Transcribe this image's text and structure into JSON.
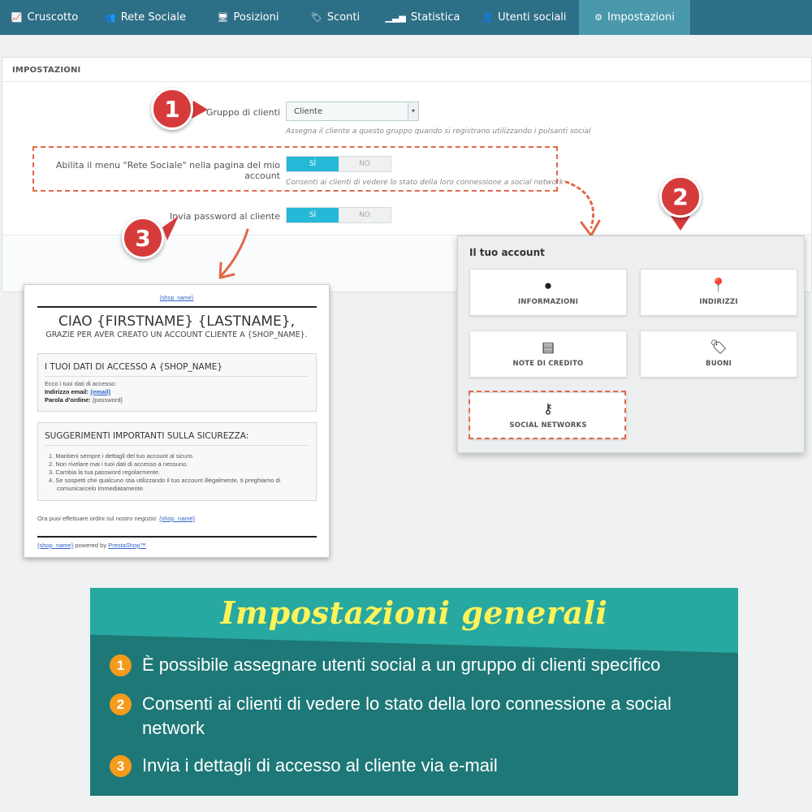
{
  "nav": {
    "tabs": [
      {
        "label": "Cruscotto",
        "icon": "chart-line-icon"
      },
      {
        "label": "Rete Sociale",
        "icon": "users-icon"
      },
      {
        "label": "Posizioni",
        "icon": "monitor-icon"
      },
      {
        "label": "Sconti",
        "icon": "tag-icon"
      },
      {
        "label": "Statistica",
        "icon": "bar-chart-icon"
      },
      {
        "label": "Utenti sociali",
        "icon": "user-icon"
      },
      {
        "label": "Impostazioni",
        "icon": "gear-icon",
        "active": true
      }
    ]
  },
  "settings": {
    "header": "IMPOSTAZIONI",
    "group_label": "Gruppo di clienti",
    "group_value": "Cliente",
    "group_hint": "Assegna il cliente a questo gruppo quando si registrano utilizzando i pulsanti social",
    "menu_label": "Abilita il menu \"Rete Sociale\" nella pagina del mio account",
    "menu_hint": "Consenti ai clienti di vedere lo stato della loro connessione a social network",
    "password_label": "Invia password al cliente",
    "toggle_yes": "SÌ",
    "toggle_no": "NO"
  },
  "badges": {
    "one": "1",
    "two": "2",
    "three": "3"
  },
  "account": {
    "title": "Il tuo account",
    "cards": [
      {
        "label": "INFORMAZIONI",
        "icon": "user-circle-icon"
      },
      {
        "label": "INDIRIZZI",
        "icon": "map-pin-icon"
      },
      {
        "label": "NOTE DI CREDITO",
        "icon": "receipt-icon"
      },
      {
        "label": "BUONI",
        "icon": "tag-icon"
      },
      {
        "label": "SOCIAL NETWORKS",
        "icon": "key-icon"
      }
    ]
  },
  "email": {
    "shop_name": "{shop_name}",
    "greeting": "CIAO {FIRSTNAME} {LASTNAME},",
    "thanks": "GRAZIE PER AVER CREATO UN ACCOUNT CLIENTE A {SHOP_NAME}.",
    "access_title": "I TUOI DATI DI ACCESSO A {SHOP_NAME}",
    "access_intro": "Ecco i tuoi dati di accesso:",
    "email_label": "Indirizzo email:",
    "email_value": "{email}",
    "password_label": "Parola d'ordine:",
    "password_value": "{password}",
    "security_title": "SUGGERIMENTI IMPORTANTI SULLA SICUREZZA:",
    "tips": [
      "1. Mantieni sempre i dettagli del tuo account al sicuro.",
      "2. Non rivelare mai i tuoi dati di accesso a nessuno.",
      "3. Cambia la tua password regolarmente.",
      "4. Se sospetti che qualcuno stia utilizzando il tuo account illegalmente, ti preghiamo di comunicarcelo immediatamente."
    ],
    "order_text": "Ora puoi effettuare ordini sul nostro negozio:",
    "powered_by": "powered by",
    "prestashop": "PrestaShop™"
  },
  "banner": {
    "title": "Impostazioni generali",
    "items": [
      {
        "num": "1",
        "text": "È possibile assegnare utenti social a un gruppo di clienti specifico"
      },
      {
        "num": "2",
        "text": "Consenti ai clienti di vedere lo stato della loro connessione a social network"
      },
      {
        "num": "3",
        "text": "Invia i dettagli di accesso al cliente via e-mail"
      }
    ]
  },
  "colors": {
    "nav_bg": "#2d6f86",
    "nav_active": "#4a98ab",
    "toggle_on": "#25b9d7",
    "badge_red": "#d63b3b",
    "dash_orange": "#e06a4a",
    "banner_dark": "#1e7877",
    "banner_light": "#27a8a0",
    "banner_title": "#fff35a",
    "bullet_orange": "#f59b1b"
  }
}
